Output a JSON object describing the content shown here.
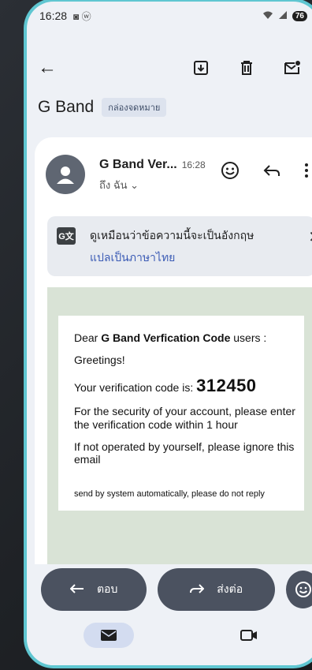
{
  "status": {
    "time": "16:28",
    "notif_icons": "◙ ⓦ",
    "battery": "76"
  },
  "toolbar": {
    "back_icon": "arrow-left-icon",
    "actions": [
      "archive-icon",
      "delete-icon",
      "mark-unread-icon"
    ]
  },
  "email": {
    "subject": "G Band",
    "label": "กล่องจดหมาย",
    "sender_name": "G Band Ver...",
    "time": "16:28",
    "to_line": "ถึง ฉัน ⌄"
  },
  "translate": {
    "message": "ดูเหมือนว่าข้อความนี้จะเป็นอังกฤษ",
    "link": "แปลเป็นภาษาไทย"
  },
  "body": {
    "greeting_prefix": "Dear ",
    "greeting_bold": "G Band Verfication Code",
    "greeting_suffix": " users :",
    "greetings": "Greetings!",
    "code_label": "Your verification code is: ",
    "code": "312450",
    "security": "For the security of your account, please enter the verification code within 1 hour",
    "ignore": "If not operated by yourself, please ignore this email",
    "footer": "send by system automatically, please do not reply"
  },
  "reply_bar": {
    "reply": "ตอบ",
    "forward": "ส่งต่อ"
  },
  "colors": {
    "frame": "#5fc6d1",
    "pill": "#4b5260",
    "mail_bg": "#d9e3d6"
  }
}
